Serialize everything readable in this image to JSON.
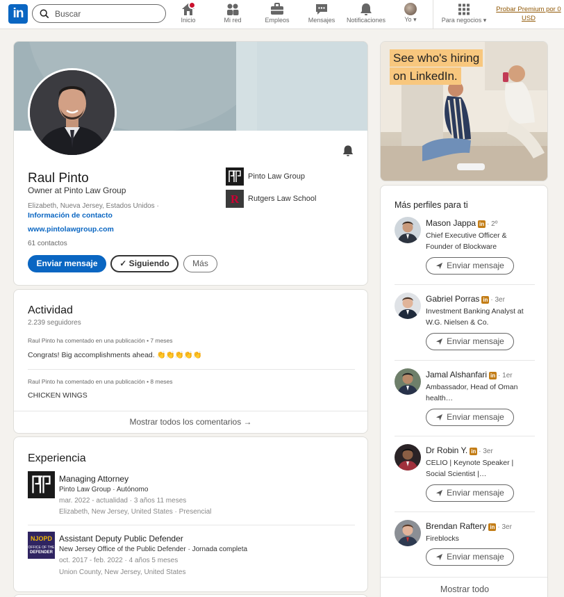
{
  "nav": {
    "logo": "in",
    "search_placeholder": "Buscar",
    "items": [
      {
        "label": "Inicio",
        "icon": "home-icon"
      },
      {
        "label": "Mi red",
        "icon": "network-icon"
      },
      {
        "label": "Empleos",
        "icon": "briefcase-icon"
      },
      {
        "label": "Mensajes",
        "icon": "messaging-icon"
      },
      {
        "label": "Notificaciones",
        "icon": "bell-icon"
      },
      {
        "label": "Yo",
        "icon": "avatar"
      },
      {
        "label": "Para negocios",
        "icon": "grid-icon"
      }
    ],
    "premium": "Probar Premium por 0 USD"
  },
  "profile": {
    "name": "Raul Pinto",
    "headline": "Owner at Pinto Law Group",
    "location": "Elizabeth, Nueva Jersey, Estados Unidos ·",
    "contact_info": "Información de contacto",
    "website": "www.pintolawgroup.com",
    "contacts": "61 contactos",
    "buttons": {
      "message": "Enviar mensaje",
      "following": "✓ Siguiendo",
      "more": "Más"
    },
    "orgs": [
      {
        "name": "Pinto Law Group",
        "logo": "PLG"
      },
      {
        "name": "Rutgers Law School",
        "logo": "R"
      }
    ]
  },
  "activity": {
    "title": "Actividad",
    "followers": "2.239 seguidores",
    "posts": [
      {
        "meta": "Raul Pinto ha comentado en una publicación • 7 meses",
        "text": "Congrats! Big accomplishments ahead. 👏👏👏👏👏"
      },
      {
        "meta": "Raul Pinto ha comentado en una publicación • 8 meses",
        "text": "CHICKEN WINGS"
      }
    ],
    "show_all": "Mostrar todos los comentarios →"
  },
  "experience": {
    "title": "Experiencia",
    "items": [
      {
        "role": "Managing Attorney",
        "company": "Pinto Law Group · Autónomo",
        "dates": "mar. 2022 - actualidad · 3 años 11 meses",
        "place": "Elizabeth, New Jersey, United States · Presencial",
        "logo": "PLG"
      },
      {
        "role": "Assistant Deputy Public Defender",
        "company": "New Jersey Office of the Public Defender · Jornada completa",
        "dates": "oct. 2017 - feb. 2022 · 4 años 5 meses",
        "place": "Union County, New Jersey, United States",
        "logo": "NJOPD"
      }
    ]
  },
  "ad": {
    "line1": "See who's hiring",
    "line2": "on LinkedIn."
  },
  "suggestions": {
    "title": "Más perfiles para ti",
    "button_label": "Enviar mensaje",
    "people": [
      {
        "name": "Mason Jappa",
        "degree": "· 2º",
        "desc": "Chief Executive Officer & Founder of Blockware"
      },
      {
        "name": "Gabriel Porras",
        "degree": "· 3er",
        "desc": "Investment Banking Analyst at W.G. Nielsen & Co."
      },
      {
        "name": "Jamal Alshanfari",
        "degree": "· 1er",
        "desc": "Ambassador, Head of Oman health…"
      },
      {
        "name": "Dr Robin Y.",
        "degree": "· 3er",
        "desc": "CELIO | Keynote Speaker | Social Scientist |…"
      },
      {
        "name": "Brendan Raftery",
        "degree": "· 3er",
        "desc": "Fireblocks"
      }
    ],
    "show_all": "Mostrar todo"
  }
}
